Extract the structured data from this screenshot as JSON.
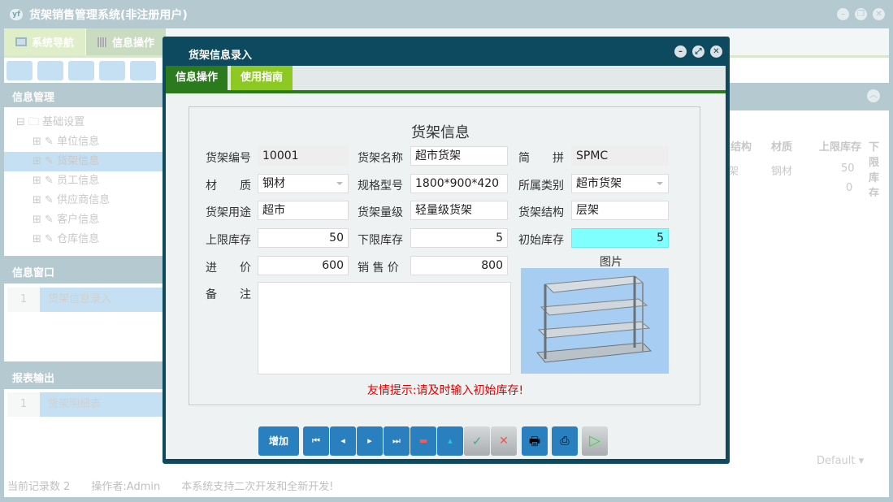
{
  "app": {
    "title": "货架销售管理系统(非注册用户)",
    "tabs": [
      "系统导航",
      "信息操作"
    ]
  },
  "left": {
    "info_mgmt": "信息管理",
    "tree_root": "基础设置",
    "tree_items": [
      "单位信息",
      "货架信息",
      "员工信息",
      "供应商信息",
      "客户信息",
      "仓库信息"
    ],
    "info_window": "信息窗口",
    "windows": [
      {
        "n": "1",
        "label": "货架信息录入"
      }
    ],
    "report": "报表输出",
    "reports": [
      {
        "n": "1",
        "label": "货架明细表"
      }
    ]
  },
  "grid": {
    "headers": [
      "货架结构",
      "材质",
      "上限库存",
      "下限库存"
    ],
    "rows": [
      [
        "层架",
        "钢材",
        "50",
        ""
      ],
      [
        "",
        "",
        "0",
        ""
      ]
    ],
    "default_select": "Default"
  },
  "status": {
    "count": "当前记录数 2",
    "operator": "操作者:Admin",
    "note": "本系统支持二次开发和全新开发!"
  },
  "dialog": {
    "title": "货架信息录入",
    "tabs": [
      "信息操作",
      "使用指南"
    ],
    "heading": "货架信息",
    "fields": {
      "code": {
        "label": "货架编号",
        "value": "10001"
      },
      "name": {
        "label": "货架名称",
        "value": "超市货架"
      },
      "pinyin": {
        "label": "简　　拼",
        "value": "SPMC"
      },
      "material": {
        "label": "材　　质",
        "value": "钢材"
      },
      "spec": {
        "label": "规格型号",
        "value": "1800*900*420"
      },
      "category": {
        "label": "所属类别",
        "value": "超市货架"
      },
      "usage": {
        "label": "货架用途",
        "value": "超市"
      },
      "level": {
        "label": "货架量级",
        "value": "轻量级货架"
      },
      "structure": {
        "label": "货架结构",
        "value": "层架"
      },
      "max_stock": {
        "label": "上限库存",
        "value": "50"
      },
      "min_stock": {
        "label": "下限库存",
        "value": "5"
      },
      "init_stock": {
        "label": "初始库存",
        "value": "5"
      },
      "cost": {
        "label": "进　　价",
        "value": "600"
      },
      "price": {
        "label": "销 售 价",
        "value": "800"
      },
      "remark": {
        "label": "备　　注",
        "value": ""
      }
    },
    "picture_label": "图片",
    "hint": "友情提示:请及时输入初始库存!",
    "buttons": {
      "add": "增加"
    }
  },
  "colors": {
    "dialog": "#0d4a5f",
    "tab_active": "#2c7a1e",
    "tab2": "#8dc922",
    "button": "#2a80bf",
    "hint": "#e00000",
    "init_stock_bg": "#80ffff"
  }
}
